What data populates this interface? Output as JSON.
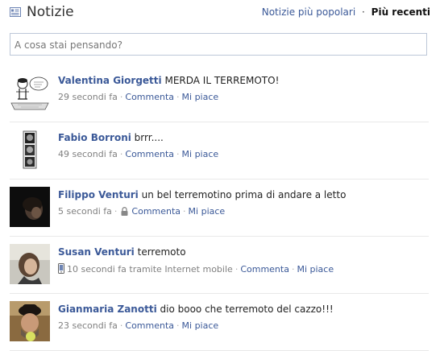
{
  "header": {
    "title": "Notizie",
    "filters": {
      "popular": "Notizie più popolari",
      "separator": "·",
      "recent": "Più recenti"
    }
  },
  "composer": {
    "placeholder": "A cosa stai pensando?"
  },
  "icons": {
    "news": "news-feed-icon",
    "lock": "lock-icon",
    "mobile": "mobile-phone-icon"
  },
  "colors": {
    "link": "#3b5998",
    "meta": "#808080",
    "border": "#bdc7d8"
  },
  "stories": [
    {
      "name": "Valentina Giorgetti",
      "message": "MERDA IL TERREMOTO!",
      "time": "29 secondi fa",
      "via": "",
      "comment": "Commenta",
      "like": "Mi piace"
    },
    {
      "name": "Fabio Borroni",
      "message": "brrr....",
      "time": "49 secondi fa",
      "via": "",
      "comment": "Commenta",
      "like": "Mi piace"
    },
    {
      "name": "Filippo Venturi",
      "message": "un bel terremotino prima di andare a letto",
      "time": "5 secondi fa",
      "via": "",
      "comment": "Commenta",
      "like": "Mi piace"
    },
    {
      "name": "Susan Venturi",
      "message": "terremoto",
      "time": "10 secondi fa",
      "via": "tramite Internet mobile",
      "comment": "Commenta",
      "like": "Mi piace"
    },
    {
      "name": "Gianmaria Zanotti",
      "message": "dio booo che terremoto del cazzo!!!",
      "time": "23 secondi fa",
      "via": "",
      "comment": "Commenta",
      "like": "Mi piace"
    }
  ]
}
